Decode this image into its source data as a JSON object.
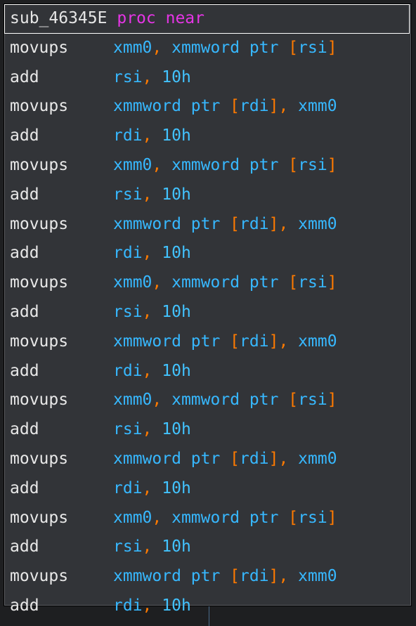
{
  "header": {
    "name": "sub_46345E",
    "kw1": "proc",
    "kw2": "near"
  },
  "colors": {
    "background": "#1e1f21",
    "panel": "#323438",
    "mnemonic": "#e8e8e8",
    "register": "#37b8ff",
    "punctuation": "#ff7a00",
    "keyword": "#e535e5"
  },
  "instructions": [
    {
      "mnem": "movups",
      "a": "xmm0",
      "comma": ",",
      "b1": "xmmword ptr ",
      "lb": "[",
      "b2": "rsi",
      "rb": "]",
      "kind": "load"
    },
    {
      "mnem": "add",
      "a": "rsi",
      "comma": ",",
      "imm": "10h",
      "kind": "add"
    },
    {
      "mnem": "movups",
      "a1": "xmmword ptr ",
      "lb": "[",
      "a2": "rdi",
      "rb": "]",
      "comma": ",",
      "b": "xmm0",
      "kind": "store"
    },
    {
      "mnem": "add",
      "a": "rdi",
      "comma": ",",
      "imm": "10h",
      "kind": "add"
    },
    {
      "mnem": "movups",
      "a": "xmm0",
      "comma": ",",
      "b1": "xmmword ptr ",
      "lb": "[",
      "b2": "rsi",
      "rb": "]",
      "kind": "load"
    },
    {
      "mnem": "add",
      "a": "rsi",
      "comma": ",",
      "imm": "10h",
      "kind": "add"
    },
    {
      "mnem": "movups",
      "a1": "xmmword ptr ",
      "lb": "[",
      "a2": "rdi",
      "rb": "]",
      "comma": ",",
      "b": "xmm0",
      "kind": "store"
    },
    {
      "mnem": "add",
      "a": "rdi",
      "comma": ",",
      "imm": "10h",
      "kind": "add"
    },
    {
      "mnem": "movups",
      "a": "xmm0",
      "comma": ",",
      "b1": "xmmword ptr ",
      "lb": "[",
      "b2": "rsi",
      "rb": "]",
      "kind": "load"
    },
    {
      "mnem": "add",
      "a": "rsi",
      "comma": ",",
      "imm": "10h",
      "kind": "add"
    },
    {
      "mnem": "movups",
      "a1": "xmmword ptr ",
      "lb": "[",
      "a2": "rdi",
      "rb": "]",
      "comma": ",",
      "b": "xmm0",
      "kind": "store"
    },
    {
      "mnem": "add",
      "a": "rdi",
      "comma": ",",
      "imm": "10h",
      "kind": "add"
    },
    {
      "mnem": "movups",
      "a": "xmm0",
      "comma": ",",
      "b1": "xmmword ptr ",
      "lb": "[",
      "b2": "rsi",
      "rb": "]",
      "kind": "load"
    },
    {
      "mnem": "add",
      "a": "rsi",
      "comma": ",",
      "imm": "10h",
      "kind": "add"
    },
    {
      "mnem": "movups",
      "a1": "xmmword ptr ",
      "lb": "[",
      "a2": "rdi",
      "rb": "]",
      "comma": ",",
      "b": "xmm0",
      "kind": "store"
    },
    {
      "mnem": "add",
      "a": "rdi",
      "comma": ",",
      "imm": "10h",
      "kind": "add"
    },
    {
      "mnem": "movups",
      "a": "xmm0",
      "comma": ",",
      "b1": "xmmword ptr ",
      "lb": "[",
      "b2": "rsi",
      "rb": "]",
      "kind": "load"
    },
    {
      "mnem": "add",
      "a": "rsi",
      "comma": ",",
      "imm": "10h",
      "kind": "add"
    },
    {
      "mnem": "movups",
      "a1": "xmmword ptr ",
      "lb": "[",
      "a2": "rdi",
      "rb": "]",
      "comma": ",",
      "b": "xmm0",
      "kind": "store"
    },
    {
      "mnem": "add",
      "a": "rdi",
      "comma": ",",
      "imm": "10h",
      "kind": "add"
    }
  ]
}
